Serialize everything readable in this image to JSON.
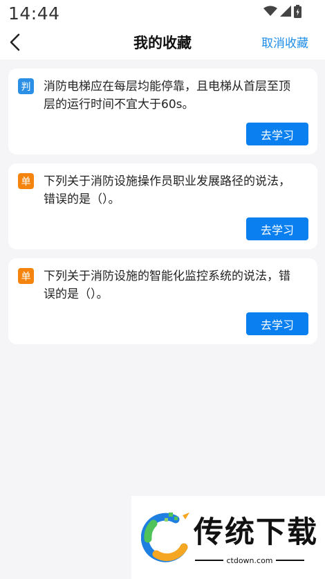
{
  "status_bar": {
    "time": "14:44"
  },
  "header": {
    "title": "我的收藏",
    "cancel_label": "取消收藏"
  },
  "cards": [
    {
      "type": "判",
      "text": "消防电梯应在每层均能停靠，且电梯从首层至顶\n层的运行时间不宜大于60s。",
      "button": "去学习"
    },
    {
      "type": "单",
      "text": "下列关于消防设施操作员职业发展路径的说法，\n错误的是（）。",
      "button": "去学习"
    },
    {
      "type": "单",
      "text": "下列关于消防设施的智能化监控系统的说法，错\n误的是（）。",
      "button": "去学习"
    }
  ],
  "watermark": {
    "brand": "传统下载",
    "url": "ctdown.com"
  },
  "colors": {
    "accent": "#0a80f0",
    "judge_badge": "#2b8fe6",
    "single_badge": "#f5840f",
    "link": "#1e8de8"
  }
}
